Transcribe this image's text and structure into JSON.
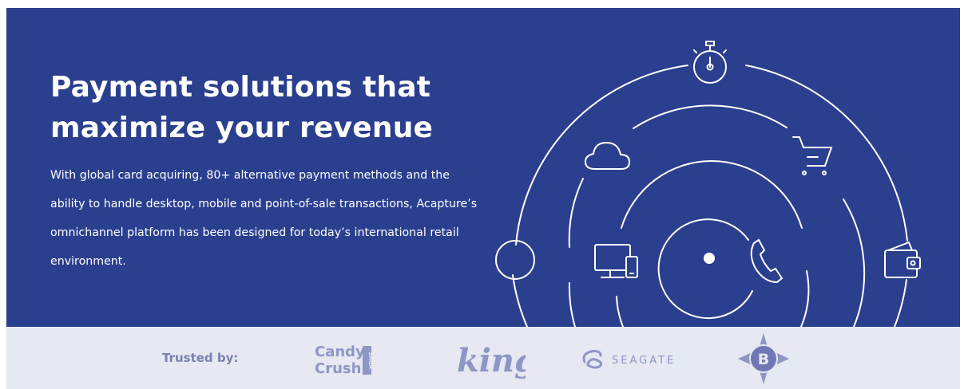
{
  "hero": {
    "headline": "Payment solutions that maximize your revenue",
    "description": "With global card acquiring, 80+ alternative payment methods and the ability to handle desktop, mobile and point-of-sale transactions, Acapture’s omnichannel platform has been designed for today’s international retail environment.",
    "background_color": "#2b3f8f",
    "icons": [
      "stopwatch-icon",
      "cloud-icon",
      "shopping-cart-icon",
      "circle-icon",
      "desktop-mobile-icon",
      "phone-icon",
      "wallet-icon",
      "center-dot-icon"
    ]
  },
  "trusted": {
    "label": "Trusted by:",
    "background_color": "#e6e8f2",
    "logos": {
      "candy_crush_line1": "Candy",
      "candy_crush_line2": "Crush",
      "candy_crush_saga": "SAGA",
      "king": "king",
      "seagate": "SEAGATE",
      "badge_letter": "B"
    }
  }
}
